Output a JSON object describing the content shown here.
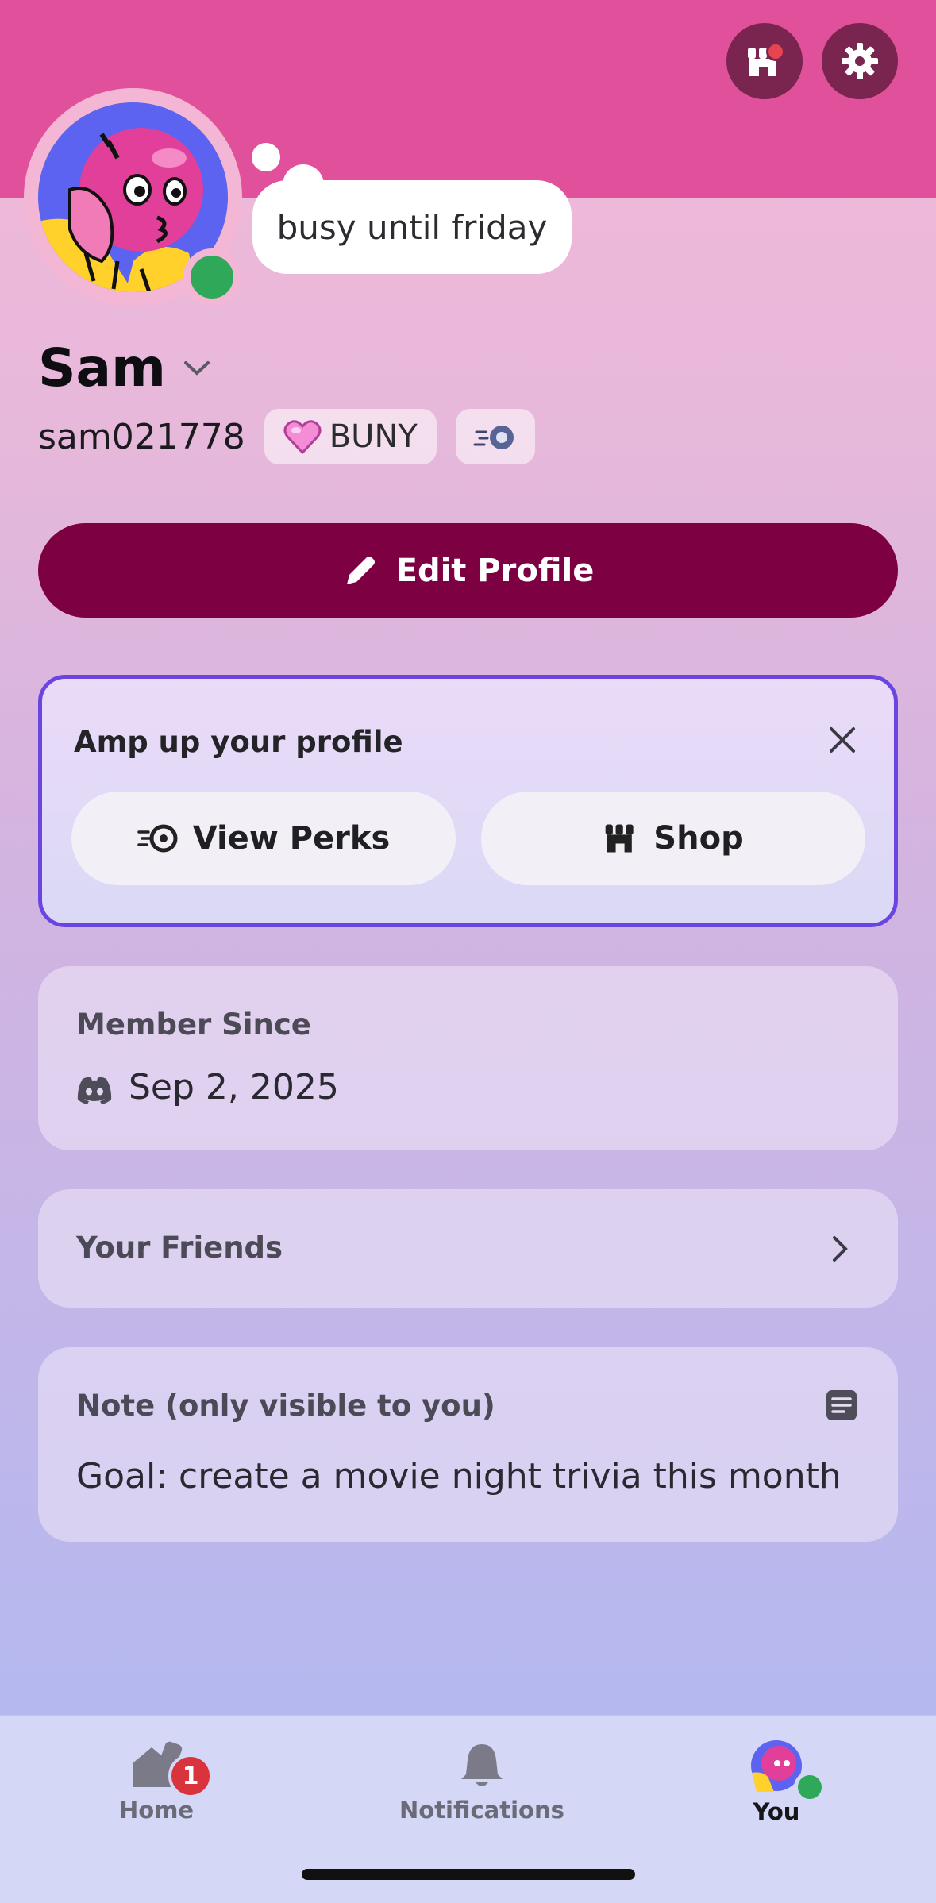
{
  "profile": {
    "custom_status": "busy until friday",
    "display_name": "Sam",
    "username": "sam021778",
    "guild_tag": "BUNY",
    "edit_button": "Edit Profile"
  },
  "promo": {
    "title": "Amp up your profile",
    "view_perks": "View Perks",
    "shop": "Shop"
  },
  "member_since": {
    "label": "Member Since",
    "date": "Sep 2, 2025"
  },
  "friends": {
    "label": "Your Friends"
  },
  "note": {
    "label": "Note (only visible to you)",
    "text": "Goal: create a movie night trivia this month"
  },
  "nav": {
    "home": "Home",
    "home_badge": "1",
    "notifications": "Notifications",
    "you": "You"
  },
  "colors": {
    "banner": "#e1509a",
    "edit_button": "#7c0042",
    "online": "#2fa85a",
    "promo_border": "#6a45e0",
    "badge": "#d9333d"
  }
}
